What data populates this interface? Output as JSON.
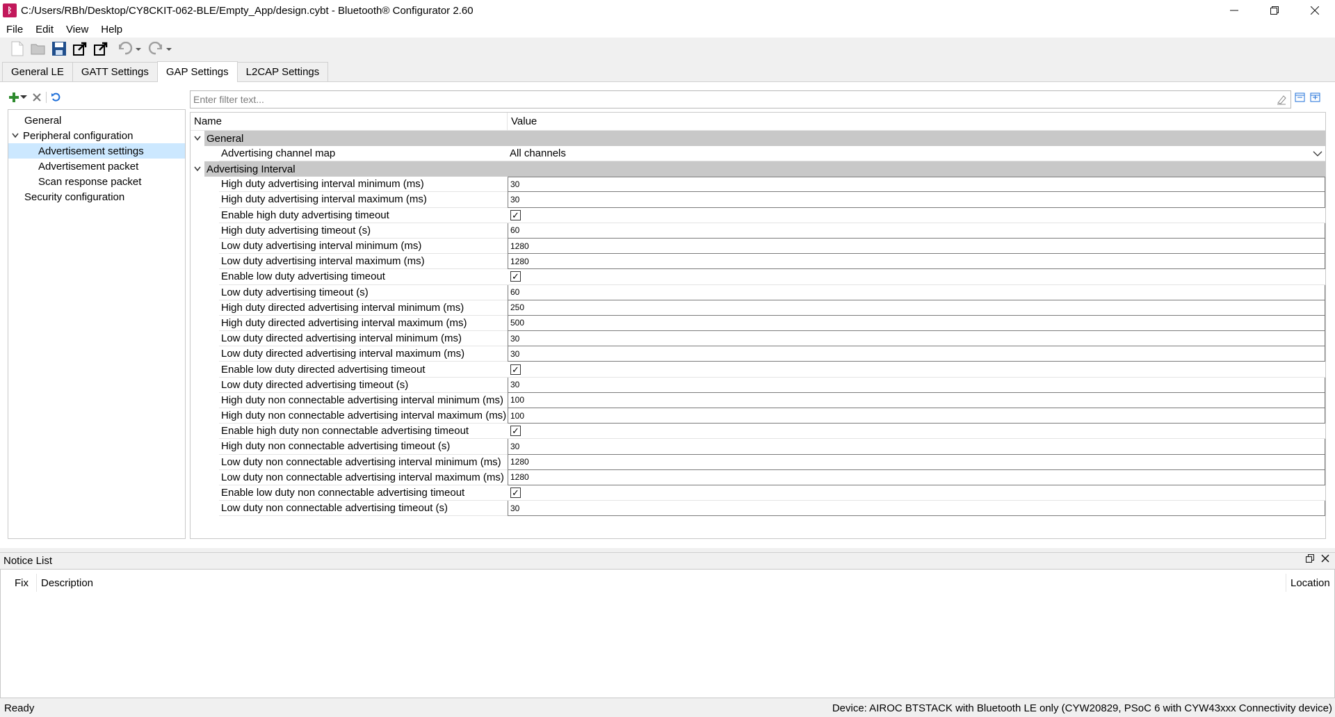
{
  "window": {
    "title": "C:/Users/RBh/Desktop/CY8CKIT-062-BLE/Empty_App/design.cybt - Bluetooth® Configurator 2.60",
    "app_icon": "bluetooth-configurator-icon"
  },
  "menu": [
    "File",
    "Edit",
    "View",
    "Help"
  ],
  "toolbar": {
    "icons": [
      "new-file-icon",
      "open-folder-icon",
      "save-icon",
      "export-icon",
      "export-alt-icon",
      "undo-icon",
      "redo-icon"
    ]
  },
  "tabs": [
    {
      "label": "General LE",
      "active": false
    },
    {
      "label": "GATT Settings",
      "active": false
    },
    {
      "label": "GAP Settings",
      "active": true
    },
    {
      "label": "L2CAP Settings",
      "active": false
    }
  ],
  "tree": [
    {
      "label": "General",
      "level": 1,
      "expandable": false,
      "selected": false
    },
    {
      "label": "Peripheral configuration",
      "level": 0,
      "expandable": true,
      "selected": false
    },
    {
      "label": "Advertisement settings",
      "level": 2,
      "expandable": false,
      "selected": true
    },
    {
      "label": "Advertisement packet",
      "level": 2,
      "expandable": false,
      "selected": false
    },
    {
      "label": "Scan response packet",
      "level": 2,
      "expandable": false,
      "selected": false
    },
    {
      "label": "Security configuration",
      "level": 1,
      "expandable": false,
      "selected": false
    }
  ],
  "filter": {
    "placeholder": "Enter filter text..."
  },
  "grid": {
    "col_name": "Name",
    "col_value": "Value",
    "sections": [
      {
        "label": "General",
        "rows": [
          {
            "name": "Advertising channel map",
            "type": "select",
            "value": "All channels"
          }
        ]
      },
      {
        "label": "Advertising Interval",
        "rows": [
          {
            "name": "High duty advertising interval minimum (ms)",
            "type": "text",
            "value": "30"
          },
          {
            "name": "High duty advertising interval maximum (ms)",
            "type": "text",
            "value": "30"
          },
          {
            "name": "Enable high duty advertising timeout",
            "type": "check",
            "value": "✓"
          },
          {
            "name": "High duty advertising timeout (s)",
            "type": "text",
            "value": "60"
          },
          {
            "name": "Low duty advertising interval minimum (ms)",
            "type": "text",
            "value": "1280"
          },
          {
            "name": "Low duty advertising interval maximum (ms)",
            "type": "text",
            "value": "1280"
          },
          {
            "name": "Enable low duty advertising timeout",
            "type": "check",
            "value": "✓"
          },
          {
            "name": "Low duty advertising timeout (s)",
            "type": "text",
            "value": "60"
          },
          {
            "name": "High duty directed advertising interval minimum (ms)",
            "type": "text",
            "value": "250"
          },
          {
            "name": "High duty directed advertising interval maximum (ms)",
            "type": "text",
            "value": "500"
          },
          {
            "name": "Low duty directed advertising interval minimum (ms)",
            "type": "text",
            "value": "30"
          },
          {
            "name": "Low duty directed advertising interval maximum (ms)",
            "type": "text",
            "value": "30"
          },
          {
            "name": "Enable low duty directed advertising timeout",
            "type": "check",
            "value": "✓"
          },
          {
            "name": "Low duty directed advertising timeout (s)",
            "type": "text",
            "value": "30"
          },
          {
            "name": "High duty non connectable advertising interval minimum (ms)",
            "type": "text",
            "value": "100"
          },
          {
            "name": "High duty non connectable advertising interval maximum (ms)",
            "type": "text",
            "value": "100"
          },
          {
            "name": "Enable high duty non connectable advertising timeout",
            "type": "check",
            "value": "✓"
          },
          {
            "name": "High duty non connectable advertising timeout (s)",
            "type": "text",
            "value": "30"
          },
          {
            "name": "Low duty non connectable advertising interval minimum (ms)",
            "type": "text",
            "value": "1280"
          },
          {
            "name": "Low duty non connectable advertising interval maximum (ms)",
            "type": "text",
            "value": "1280"
          },
          {
            "name": "Enable low duty non connectable advertising timeout",
            "type": "check",
            "value": "✓"
          },
          {
            "name": "Low duty non connectable advertising timeout (s)",
            "type": "text",
            "value": "30"
          }
        ]
      }
    ]
  },
  "notice": {
    "title": "Notice List",
    "col_fix": "Fix",
    "col_desc": "Description",
    "col_loc": "Location"
  },
  "status": {
    "left": "Ready",
    "right": "Device: AIROC BTSTACK with Bluetooth LE only (CYW20829, PSoC 6 with CYW43xxx Connectivity device)"
  },
  "colors": {
    "selection": "#cce8ff",
    "section_header": "#c8c8c8",
    "add_icon": "#2e8b2e",
    "refresh_icon": "#1e6fd9"
  }
}
